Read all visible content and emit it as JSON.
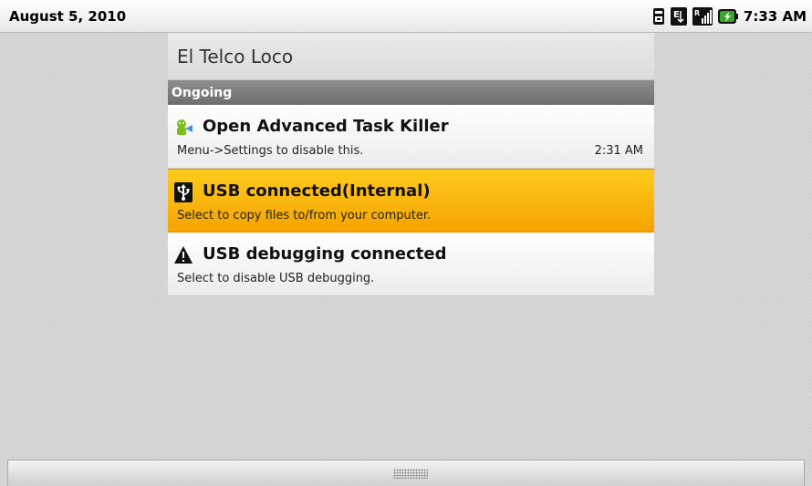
{
  "status_bar": {
    "date": "August 5, 2010",
    "time": "7:33 AM",
    "icons": [
      "usb-debug-icon",
      "data-3g-icon",
      "signal-bars-icon",
      "battery-charging-icon"
    ]
  },
  "panel": {
    "carrier": "El Telco Loco",
    "section_header": "Ongoing",
    "notifications": [
      {
        "icon": "android-task-killer-icon",
        "title": "Open Advanced Task Killer",
        "text": "Menu->Settings to disable this.",
        "time": "2:31 AM",
        "highlighted": false
      },
      {
        "icon": "usb-icon",
        "title": "USB connected(Internal)",
        "text": "Select to copy files to/from your computer.",
        "time": "",
        "highlighted": true
      },
      {
        "icon": "warning-icon",
        "title": "USB debugging connected",
        "text": "Select to disable USB debugging.",
        "time": "",
        "highlighted": false
      }
    ]
  },
  "bottom_bar": {
    "handle": "drag-handle-grip"
  },
  "colors": {
    "highlight": "#ffbf00",
    "section_header_bg": "#7d7d7d",
    "battery_green": "#3aa52b"
  }
}
